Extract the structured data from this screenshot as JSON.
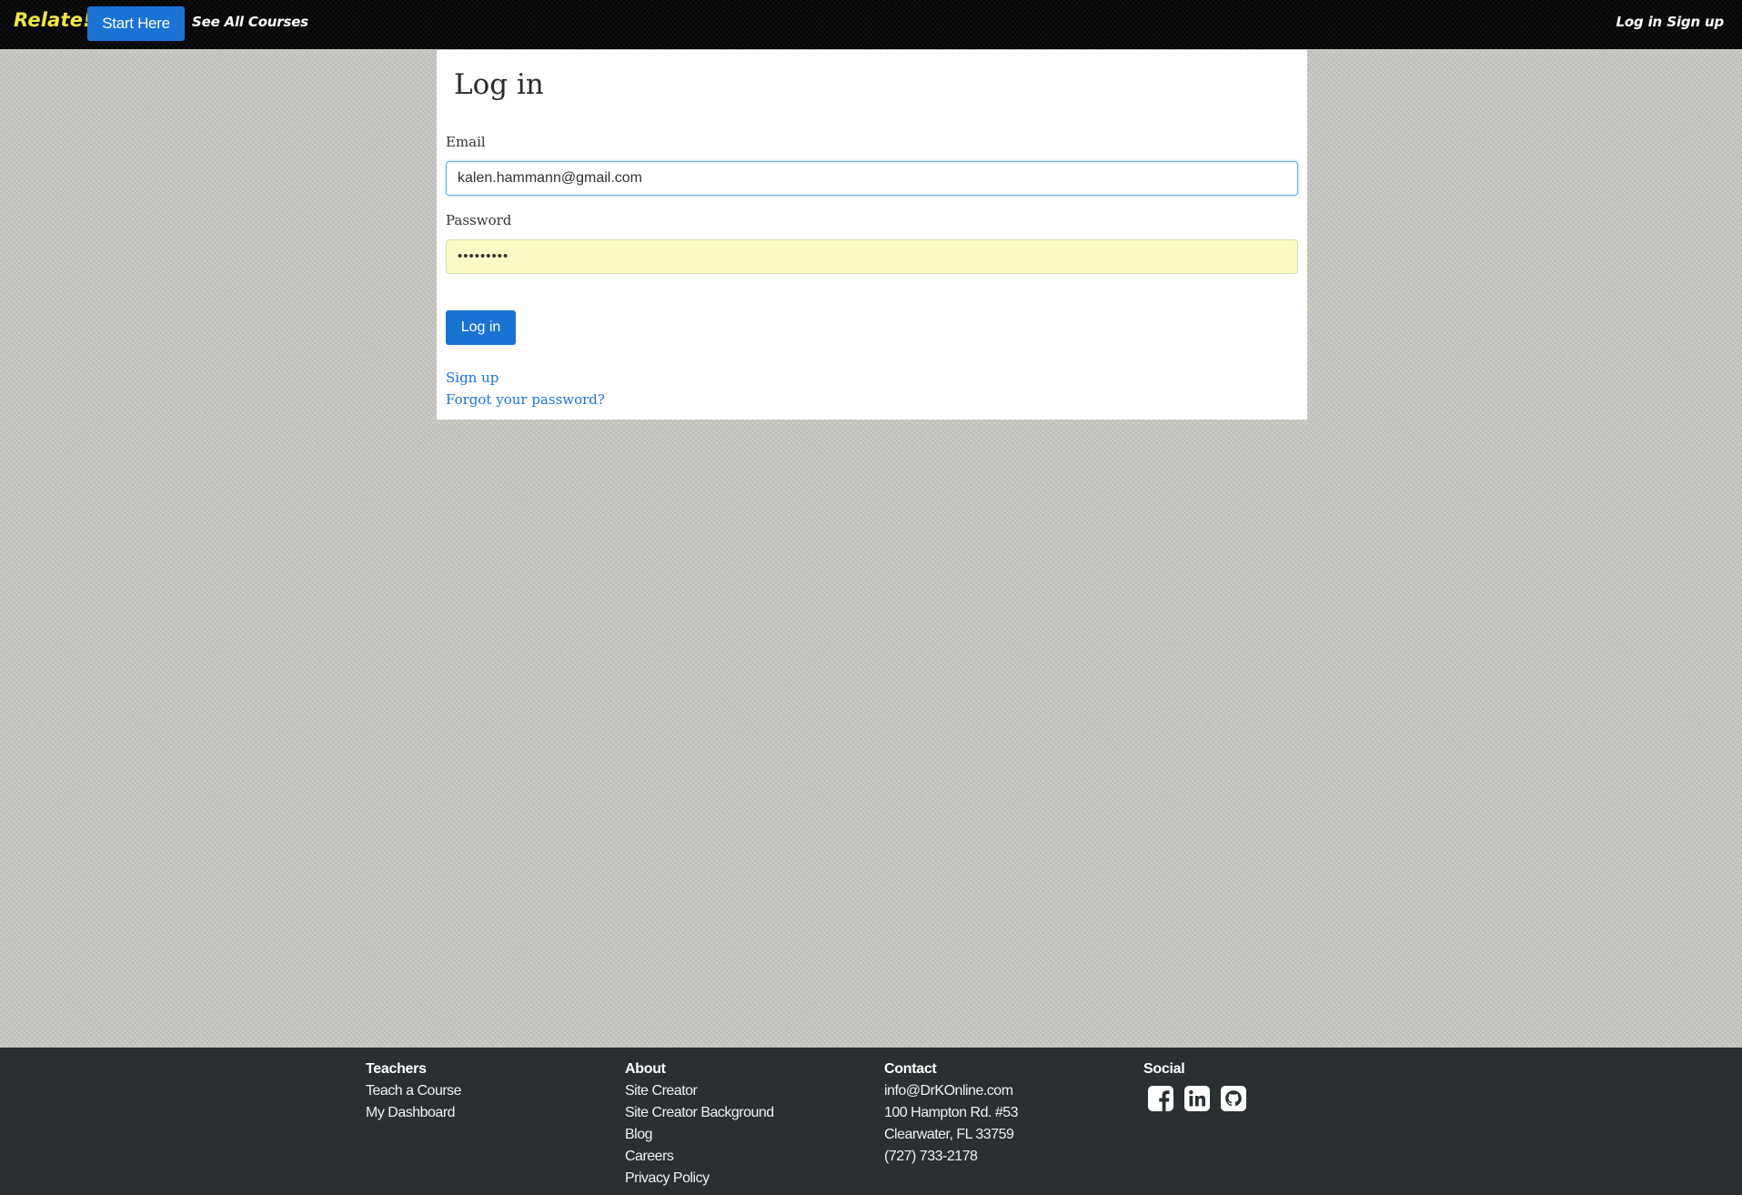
{
  "navbar": {
    "brand": "Relate!",
    "start_here": "Start Here",
    "see_all_courses": "See All Courses",
    "log_in": "Log in",
    "sign_up": "Sign up"
  },
  "login": {
    "title": "Log in",
    "email_label": "Email",
    "email_value": "kalen.hammann@gmail.com",
    "password_label": "Password",
    "password_value": "•••••••••",
    "submit_label": "Log in",
    "signup_link": "Sign up",
    "forgot_link": "Forgot your password?"
  },
  "footer": {
    "teachers": {
      "heading": "Teachers",
      "items": [
        "Teach a Course",
        "My Dashboard"
      ]
    },
    "about": {
      "heading": "About",
      "items": [
        "Site Creator",
        "Site Creator Background",
        "Blog",
        "Careers",
        "Privacy Policy"
      ]
    },
    "contact": {
      "heading": "Contact",
      "items": [
        "info@DrKOnline.com",
        "100 Hampton Rd. #53",
        "Clearwater, FL 33759",
        "(727) 733-2178"
      ]
    },
    "social": {
      "heading": "Social",
      "icons": [
        "facebook-icon",
        "linkedin-icon",
        "github-icon"
      ]
    }
  },
  "colors": {
    "accent": "#1a73d3",
    "brand": "#f2e64a",
    "navbar_bg": "#050505",
    "footer_bg": "#2a3032",
    "autofill_bg": "#fafbc4"
  }
}
